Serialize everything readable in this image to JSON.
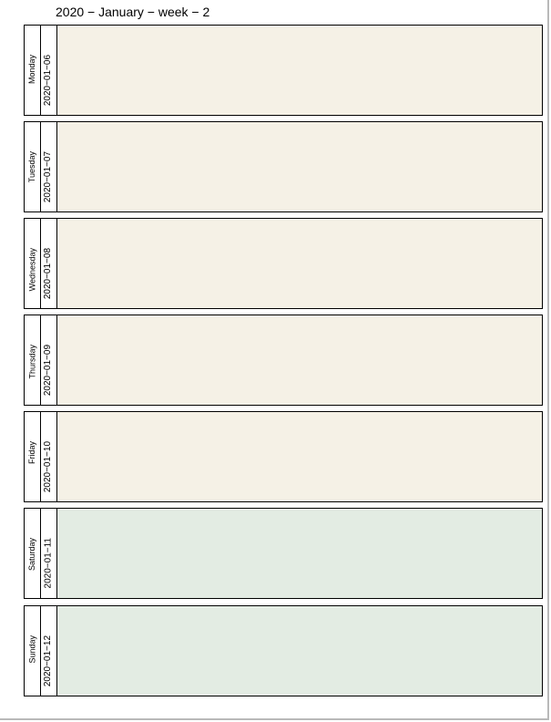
{
  "header": {
    "title": "2020 − January − week − 2"
  },
  "colors": {
    "weekday_fill": "#f5f1e6",
    "weekend_fill": "#e3ece3",
    "border": "#000000"
  },
  "days": [
    {
      "name": "Monday",
      "date": "2020−01−06",
      "weekend": false
    },
    {
      "name": "Tuesday",
      "date": "2020−01−07",
      "weekend": false
    },
    {
      "name": "Wednesday",
      "date": "2020−01−08",
      "weekend": false
    },
    {
      "name": "Thursday",
      "date": "2020−01−09",
      "weekend": false
    },
    {
      "name": "Friday",
      "date": "2020−01−10",
      "weekend": false
    },
    {
      "name": "Saturday",
      "date": "2020−01−11",
      "weekend": true
    },
    {
      "name": "Sunday",
      "date": "2020−01−12",
      "weekend": true
    }
  ]
}
